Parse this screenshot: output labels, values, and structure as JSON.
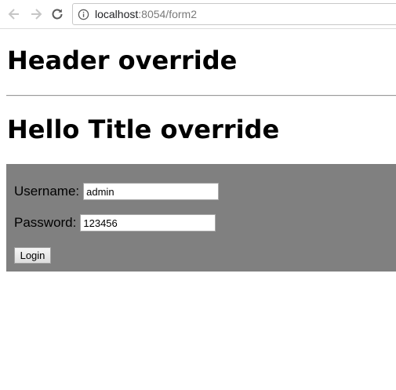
{
  "browser": {
    "url_host": "localhost",
    "url_path": ":8054/form2",
    "icons": {
      "back": "arrow-left-icon",
      "forward": "arrow-right-icon",
      "reload": "reload-icon",
      "info": "info-icon"
    }
  },
  "page": {
    "header": "Header override",
    "title": "Hello Title override"
  },
  "form": {
    "username_label": "Username:",
    "username_value": "admin",
    "password_label": "Password:",
    "password_value": "123456",
    "login_label": "Login",
    "panel_color": "#808080"
  }
}
